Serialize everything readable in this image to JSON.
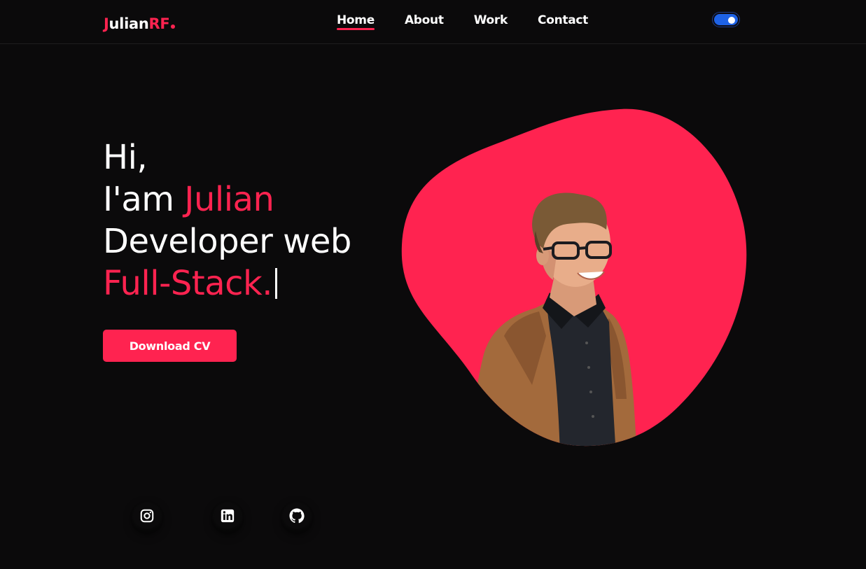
{
  "brand": {
    "logo_first": "J",
    "logo_mid": "ulian",
    "logo_accent": "RF",
    "accent_color": "#ff2350",
    "toggle_color": "#1e62e6"
  },
  "nav": {
    "items": [
      {
        "label": "Home",
        "active": true
      },
      {
        "label": "About",
        "active": false
      },
      {
        "label": "Work",
        "active": false
      },
      {
        "label": "Contact",
        "active": false
      }
    ],
    "theme_toggle": "on"
  },
  "hero": {
    "greeting": "Hi,",
    "intro_prefix": "I'am ",
    "name": "Julian",
    "role_line1": "Developer web",
    "role_line2": "Full-Stack.",
    "cta_label": "Download CV"
  },
  "socials": [
    {
      "icon": "instagram-icon"
    },
    {
      "icon": "linkedin-icon"
    },
    {
      "icon": "github-icon"
    }
  ]
}
